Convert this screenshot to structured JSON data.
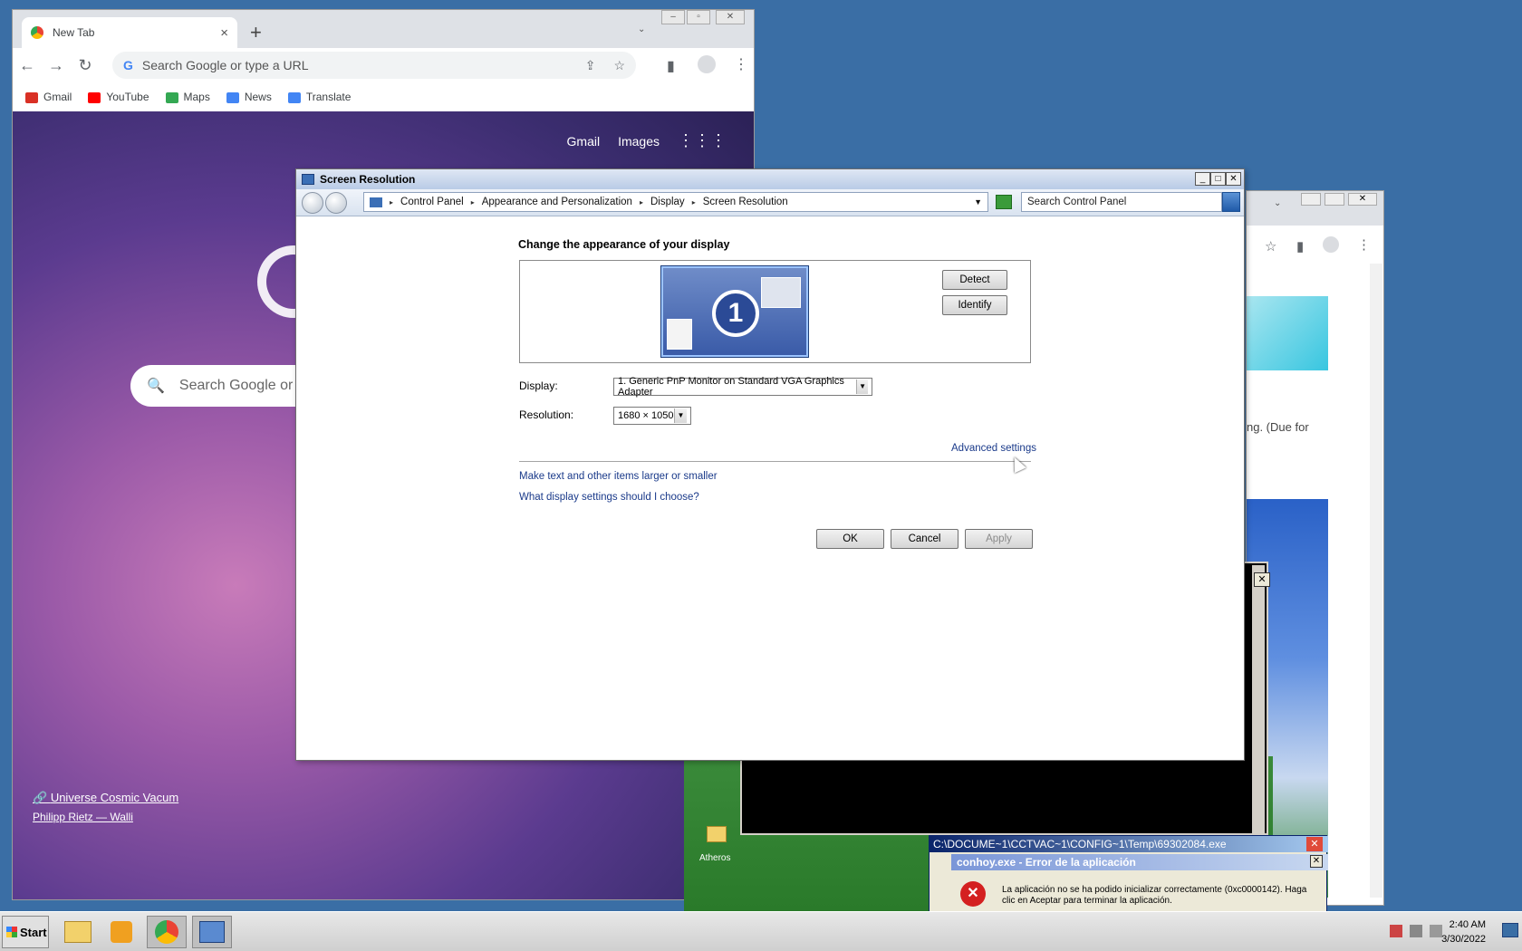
{
  "chrome": {
    "tab_title": "New Tab",
    "tab_close": "×",
    "new_tab": "+",
    "omnibox_placeholder": "Search Google or type a URL",
    "bookmarks": [
      {
        "label": "Gmail",
        "color": "#d93025"
      },
      {
        "label": "YouTube",
        "color": "#ff0000"
      },
      {
        "label": "Maps",
        "color": "#34a853"
      },
      {
        "label": "News",
        "color": "#4285f4"
      },
      {
        "label": "Translate",
        "color": "#4285f4"
      }
    ],
    "top_links": {
      "gmail": "Gmail",
      "images": "Images"
    },
    "search_placeholder": "Search Google or t",
    "credit_title": "Universe Cosmic Vacum",
    "credit_author": "Philipp Rietz — Walli"
  },
  "chrome2": {
    "snippet": "ng. (Due for"
  },
  "xp": {
    "desktop_icons": [
      "Atheros"
    ],
    "cmd_title": "C:\\DOCUME~1\\CCTVAC~1\\CONFIG~1\\Temp\\69302084.exe",
    "error_title": "conhoy.exe - Error de la aplicación",
    "error_message": "La aplicación no se ha podido inicializar correctamente (0xc0000142). Haga clic en Aceptar para terminar la aplicación."
  },
  "dialog": {
    "title": "Screen Resolution",
    "breadcrumb": [
      "Control Panel",
      "Appearance and Personalization",
      "Display",
      "Screen Resolution"
    ],
    "search_placeholder": "Search Control Panel",
    "heading": "Change the appearance of your display",
    "monitor_number": "1",
    "detect_label": "Detect",
    "identify_label": "Identify",
    "display_label": "Display:",
    "display_value": "1. Generic PnP Monitor on Standard VGA Graphics Adapter",
    "resolution_label": "Resolution:",
    "resolution_value": "1680 × 1050",
    "advanced_link": "Advanced settings",
    "link_text_size": "Make text and other items larger or smaller",
    "link_help": "What display settings should I choose?",
    "ok_label": "OK",
    "cancel_label": "Cancel",
    "apply_label": "Apply"
  },
  "taskbar": {
    "start_label": "Start",
    "time": "2:40 AM",
    "date": "3/30/2022"
  }
}
